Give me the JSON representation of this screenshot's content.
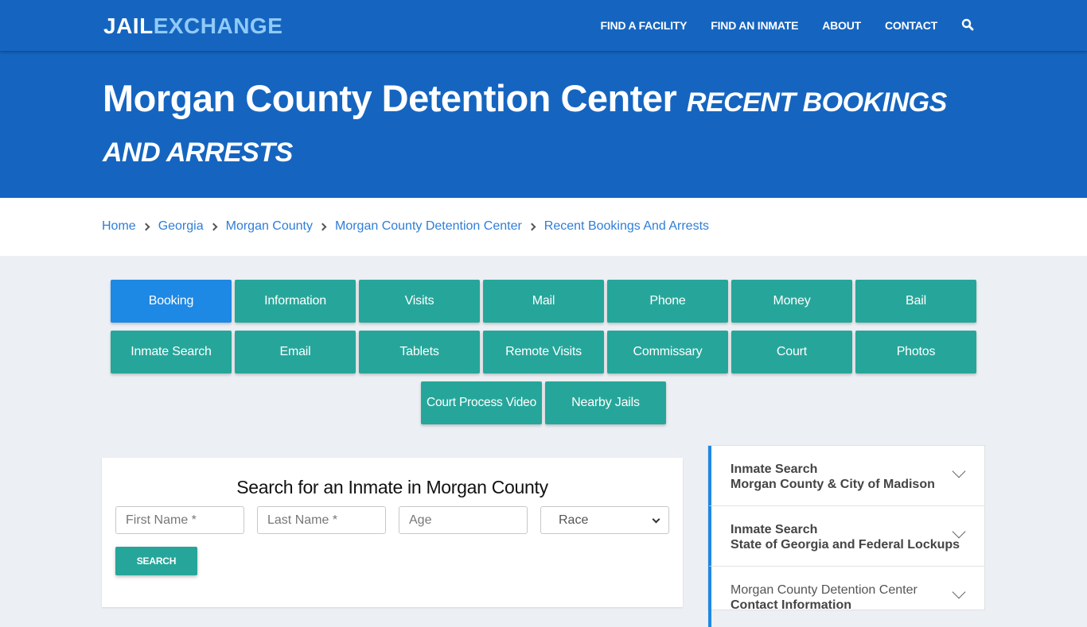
{
  "brand": {
    "part1": "JAIL",
    "part2": "EXCHANGE"
  },
  "nav": {
    "links": [
      "FIND A FACILITY",
      "FIND AN INMATE",
      "ABOUT",
      "CONTACT"
    ],
    "search_icon": "search-icon"
  },
  "hero": {
    "title": "Morgan County Detention Center",
    "subtitle": "RECENT BOOKINGS AND ARRESTS"
  },
  "breadcrumb": [
    "Home",
    "Georgia",
    "Morgan County",
    "Morgan County Detention Center",
    "Recent Bookings And Arrests"
  ],
  "tabs": {
    "row1": [
      "Booking",
      "Information",
      "Visits",
      "Mail",
      "Phone",
      "Money",
      "Bail"
    ],
    "row2": [
      "Inmate Search",
      "Email",
      "Tablets",
      "Remote Visits",
      "Commissary",
      "Court",
      "Photos"
    ],
    "row3": [
      "Court Process Video",
      "Nearby Jails"
    ],
    "active": "Booking"
  },
  "search": {
    "heading": "Search for an Inmate in Morgan County",
    "first_name_placeholder": "First Name *",
    "last_name_placeholder": "Last Name *",
    "age_placeholder": "Age",
    "race_selected": "Race",
    "button": "SEARCH"
  },
  "sidebar": {
    "items": [
      {
        "line1": "Inmate Search",
        "line2": "Morgan County & City of Madison"
      },
      {
        "line1": "Inmate Search",
        "line2": "State of Georgia and Federal Lockups"
      },
      {
        "line1": "Morgan County Detention Center",
        "line2": "Contact Information"
      }
    ]
  },
  "colors": {
    "primary_blue": "#1565c0",
    "logo_light": "#90caf9",
    "teal": "#26a69a",
    "active_tab": "#1e88e5",
    "link": "#2f7ed8"
  }
}
